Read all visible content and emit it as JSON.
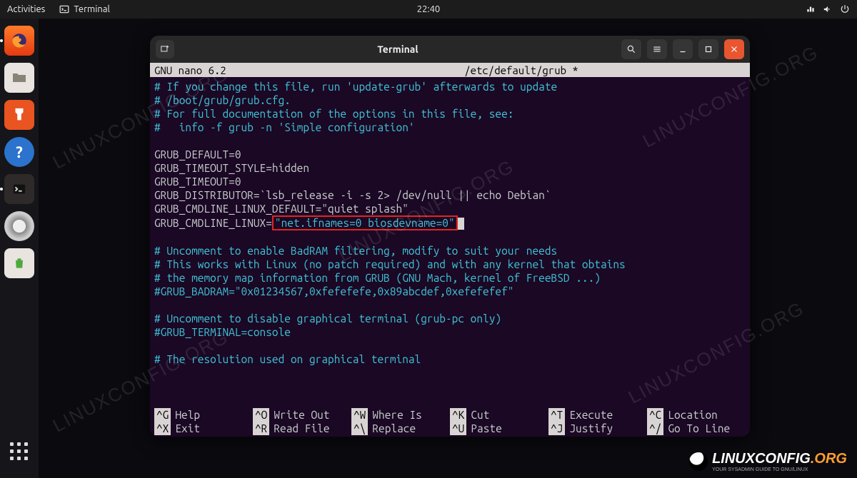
{
  "topbar": {
    "activities": "Activities",
    "term_label": "Terminal",
    "clock": "22:40"
  },
  "window": {
    "title": "Terminal"
  },
  "nano": {
    "app": "GNU nano 6.2",
    "file": "/etc/default/grub *"
  },
  "lines": [
    {
      "cls": "c-comment",
      "text": "# If you change this file, run 'update-grub' afterwards to update"
    },
    {
      "cls": "c-comment",
      "text": "# /boot/grub/grub.cfg."
    },
    {
      "cls": "c-comment",
      "text": "# For full documentation of the options in this file, see:"
    },
    {
      "cls": "c-comment",
      "text": "#   info -f grub -n 'Simple configuration'"
    },
    {
      "cls": "",
      "text": ""
    },
    {
      "cls": "c-var",
      "text": "GRUB_DEFAULT=0"
    },
    {
      "cls": "c-var",
      "text": "GRUB_TIMEOUT_STYLE=hidden"
    },
    {
      "cls": "c-var",
      "text": "GRUB_TIMEOUT=0"
    },
    {
      "cls": "c-var",
      "text": "GRUB_DISTRIBUTOR=`lsb_release -i -s 2> /dev/null || echo Debian`"
    },
    {
      "cls": "c-var",
      "text": "GRUB_CMDLINE_LINUX_DEFAULT=\"quiet splash\""
    }
  ],
  "highlight_line": {
    "prefix": "GRUB_CMDLINE_LINUX=",
    "highlighted": "\"net.ifnames=0 biosdevname=0\""
  },
  "lines_after": [
    {
      "cls": "",
      "text": ""
    },
    {
      "cls": "c-comment",
      "text": "# Uncomment to enable BadRAM filtering, modify to suit your needs"
    },
    {
      "cls": "c-comment",
      "text": "# This works with Linux (no patch required) and with any kernel that obtains"
    },
    {
      "cls": "c-comment",
      "text": "# the memory map information from GRUB (GNU Mach, kernel of FreeBSD ...)"
    },
    {
      "cls": "c-comment",
      "text": "#GRUB_BADRAM=\"0x01234567,0xfefefefe,0x89abcdef,0xefefefef\""
    },
    {
      "cls": "",
      "text": ""
    },
    {
      "cls": "c-comment",
      "text": "# Uncomment to disable graphical terminal (grub-pc only)"
    },
    {
      "cls": "c-comment",
      "text": "#GRUB_TERMINAL=console"
    },
    {
      "cls": "",
      "text": ""
    },
    {
      "cls": "c-comment",
      "text": "# The resolution used on graphical terminal"
    }
  ],
  "shortcuts": [
    {
      "key": "^G",
      "label": "Help"
    },
    {
      "key": "^O",
      "label": "Write Out"
    },
    {
      "key": "^W",
      "label": "Where Is"
    },
    {
      "key": "^K",
      "label": "Cut"
    },
    {
      "key": "^T",
      "label": "Execute"
    },
    {
      "key": "^C",
      "label": "Location"
    },
    {
      "key": "^X",
      "label": "Exit"
    },
    {
      "key": "^R",
      "label": "Read File"
    },
    {
      "key": "^\\",
      "label": "Replace"
    },
    {
      "key": "^U",
      "label": "Paste"
    },
    {
      "key": "^J",
      "label": "Justify"
    },
    {
      "key": "^/",
      "label": "Go To Line"
    }
  ],
  "watermark": "LINUXCONFIG.ORG",
  "brand": {
    "name": "LINUXCONFIG",
    "suffix": ".ORG",
    "tag": "YOUR SYSADMIN GUIDE TO GNU/LINUX"
  }
}
